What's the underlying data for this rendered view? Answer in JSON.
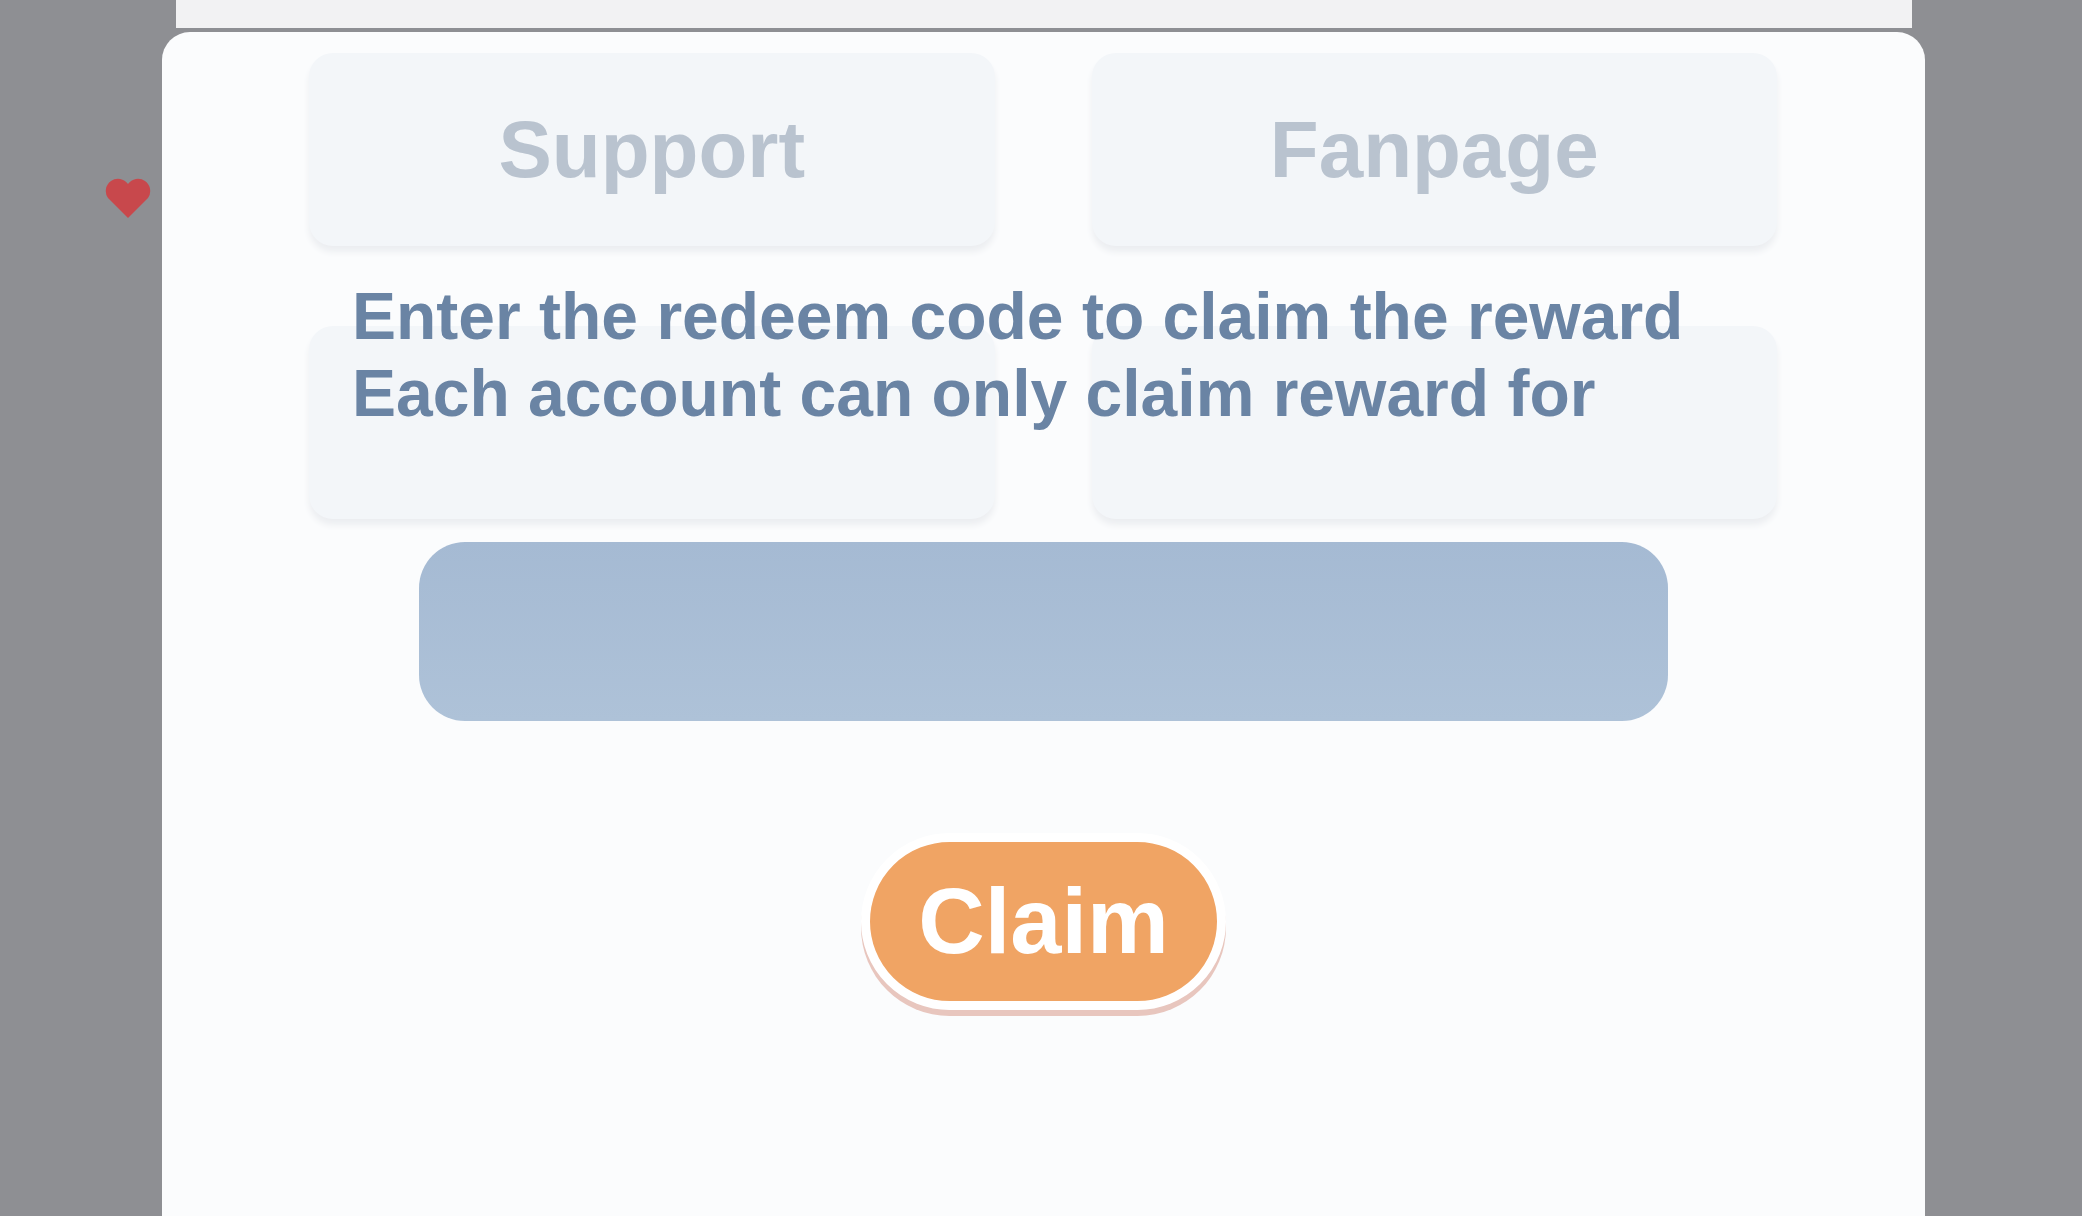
{
  "background_buttons": [
    {
      "label": "Support"
    },
    {
      "label": "Fanpage"
    }
  ],
  "dialog": {
    "lines": [
      "Enter the redeem code to claim the reward",
      "Each account can only claim reward for"
    ],
    "code_field": {
      "kind": "input"
    },
    "claim_button": {
      "label": "Claim"
    }
  }
}
